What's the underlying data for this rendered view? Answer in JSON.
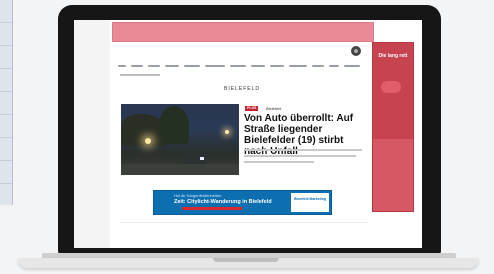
{
  "page": {
    "site_section": "BIELEFELD",
    "article": {
      "badge": "PLUS",
      "topic": "Bielefeld",
      "headline": "Von Auto überrollt: Auf Straße liegender Bielefelder (19) stirbt nach Unfall"
    },
    "right_ad": {
      "label": "Die lang rett"
    },
    "banner": {
      "kicker": "Hol dir Kärgenfeldenheiten",
      "title": "Zeit: Citylicht-Wanderung in Bielefeld",
      "side_text": "Bielefeld Marketing"
    }
  },
  "colors": {
    "ad_pink": "#e98a96",
    "ad_red": "#c6434f",
    "badge_red": "#c7232e",
    "banner_blue": "#0e6fb0"
  }
}
